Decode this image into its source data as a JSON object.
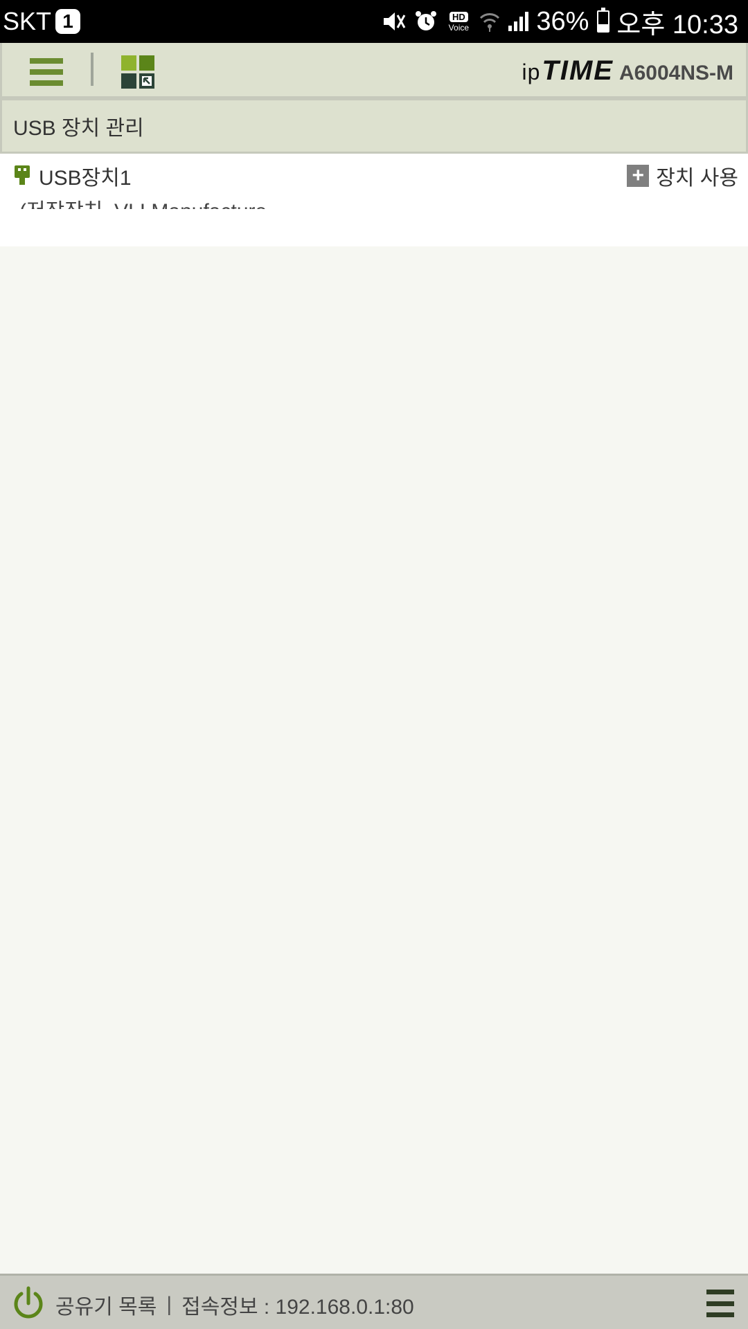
{
  "status_bar": {
    "carrier": "SKT",
    "carrier_badge": "1",
    "hd_badge": "HD",
    "voice_label": "Voice",
    "battery": "36%",
    "battery_level": 0.36,
    "time": "오후 10:33",
    "icons": [
      "mute-vibrate-icon",
      "alarm-icon",
      "hd-voice-icon",
      "wifi-icon",
      "signal-icon",
      "battery-icon"
    ]
  },
  "header": {
    "brand_ip": "ip",
    "brand_time": "TIME",
    "model": "A6004NS-M",
    "colors": {
      "background": "#dde1cf",
      "accent": "#6b8c31"
    }
  },
  "section": {
    "title": "USB 장치 관리"
  },
  "usb_devices": [
    {
      "name": "USB장치1",
      "description": "(저장장치, VLI Manufacture",
      "action_label": "장치 사용"
    }
  ],
  "bottom_bar": {
    "router_list": "공유기 목록",
    "separator": "|",
    "connection_info": "접속정보 : 192.168.0.1:80"
  }
}
